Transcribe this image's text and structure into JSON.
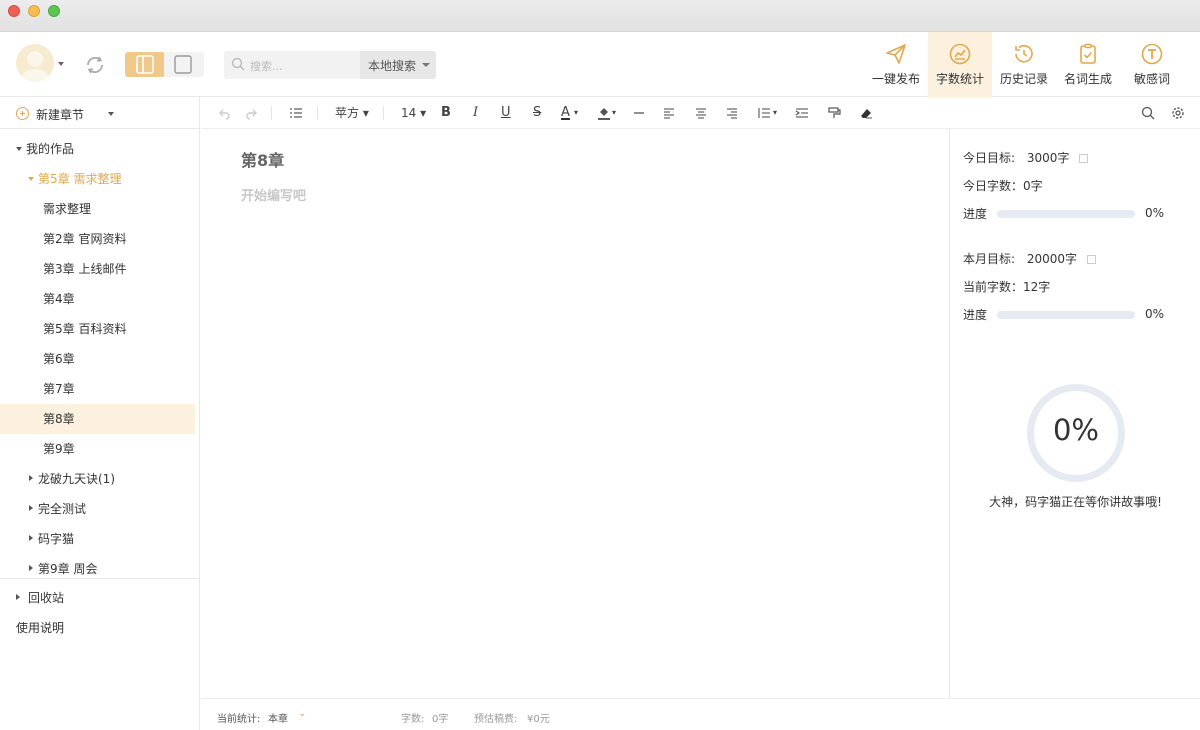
{
  "toolbar": {
    "search": {
      "placeholder": "搜索...",
      "scope": "本地搜索"
    },
    "tools": [
      {
        "label": "一键发布",
        "icon": "paper-plane-icon"
      },
      {
        "label": "字数统计",
        "icon": "chart-icon",
        "active": true
      },
      {
        "label": "历史记录",
        "icon": "history-icon"
      },
      {
        "label": "名词生成",
        "icon": "checklist-icon"
      },
      {
        "label": "敏感词",
        "icon": "text-t-icon"
      }
    ]
  },
  "sidebar": {
    "new_chapter": "新建章节",
    "tree": [
      {
        "label": "我的作品",
        "level": 0,
        "expanded": true
      },
      {
        "label": "第5章 需求整理",
        "level": 1,
        "expanded": true,
        "current": true
      },
      {
        "label": "需求整理",
        "level": 2
      },
      {
        "label": "第2章 官网资料",
        "level": 2
      },
      {
        "label": "第3章 上线邮件",
        "level": 2
      },
      {
        "label": "第4章",
        "level": 2
      },
      {
        "label": "第5章 百科资料",
        "level": 2
      },
      {
        "label": "第6章",
        "level": 2
      },
      {
        "label": "第7章",
        "level": 2
      },
      {
        "label": "第8章",
        "level": 2,
        "selected": true
      },
      {
        "label": "第9章",
        "level": 2
      },
      {
        "label": "龙破九天诀(1)",
        "level": 1,
        "expanded": false
      },
      {
        "label": "完全测试",
        "level": 1,
        "expanded": false
      },
      {
        "label": "码字猫",
        "level": 1,
        "expanded": false
      },
      {
        "label": "第9章 周会",
        "level": 1,
        "expanded": false
      }
    ],
    "recycle": "回收站",
    "help": "使用说明"
  },
  "format_bar": {
    "font": "苹方",
    "size": "14"
  },
  "editor": {
    "title": "第8章",
    "placeholder": "开始编写吧"
  },
  "stats": {
    "today_goal_label": "今日目标:",
    "today_goal": "3000字",
    "today_words": "今日字数：0字",
    "progress_label": "进度",
    "today_progress": 0,
    "today_pct": "0%",
    "month_goal_label": "本月目标:",
    "month_goal": "20000字",
    "current_words": "当前字数：12字",
    "month_progress": 0,
    "month_pct": "0%",
    "ring_pct": "0%",
    "cheer": "大神，码字猫正在等你讲故事哦!"
  },
  "statusbar": {
    "stat_label": "当前统计:",
    "stat_scope": "本章",
    "words_label": "字数:",
    "words": "0字",
    "fee_label": "预估稿费:",
    "fee": "¥0元"
  },
  "colors": {
    "accent": "#e5a74b",
    "active_bg": "#fbf1de",
    "progress_track": "#e6eaf2"
  }
}
